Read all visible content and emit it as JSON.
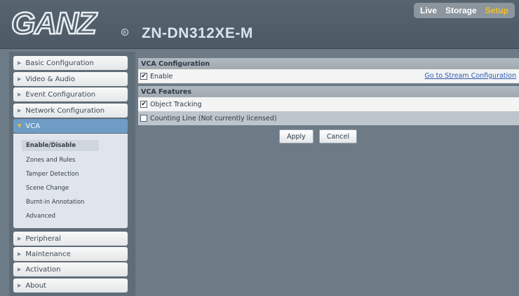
{
  "brand": {
    "logo_text": "GANZ",
    "registered_mark": "®"
  },
  "header": {
    "model": "ZN-DN312XE-M"
  },
  "topnav": {
    "items": [
      "Live",
      "Storage",
      "Setup"
    ],
    "active": "Setup"
  },
  "sidebar": {
    "items": [
      {
        "label": "Basic Configuration"
      },
      {
        "label": "Video & Audio"
      },
      {
        "label": "Event Configuration"
      },
      {
        "label": "Network Configuration"
      },
      {
        "label": "VCA"
      },
      {
        "label": "Peripheral"
      },
      {
        "label": "Maintenance"
      },
      {
        "label": "Activation"
      },
      {
        "label": "About"
      }
    ],
    "vca_subitems": [
      {
        "label": "Enable/Disable"
      },
      {
        "label": "Zones and Rules"
      },
      {
        "label": "Tamper Detection"
      },
      {
        "label": "Scene Change"
      },
      {
        "label": "Burnt-in Annotation"
      },
      {
        "label": "Advanced"
      }
    ]
  },
  "main": {
    "vca_config": {
      "title": "VCA Configuration",
      "enable_label": "Enable",
      "enable_checked": true,
      "link": "Go to Stream Configuration"
    },
    "vca_features": {
      "title": "VCA Features",
      "object_tracking_label": "Object Tracking",
      "object_tracking_checked": true,
      "counting_line_label": "Counting Line (Not currently licensed)",
      "counting_line_checked": false
    },
    "buttons": {
      "apply": "Apply",
      "cancel": "Cancel"
    }
  },
  "colors": {
    "accent_active": "#f4c020",
    "selected_menu": "#6f9cc4",
    "link": "#2a58b4"
  }
}
